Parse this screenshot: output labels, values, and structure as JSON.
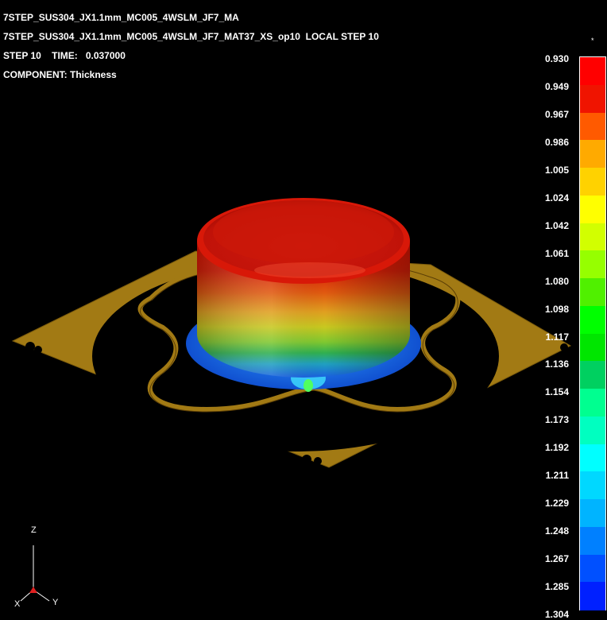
{
  "header": {
    "line1": "7STEP_SUS304_JX1.1mm_MC005_4WSLM_JF7_MA",
    "line2": "7STEP_SUS304_JX1.1mm_MC005_4WSLM_JF7_MAT37_XS_op10  LOCAL STEP 10",
    "step_label": "STEP 10    TIME:",
    "time_value": "0.037000",
    "component": "COMPONENT: Thickness"
  },
  "legend": {
    "marker": "*",
    "labels": [
      "0.930",
      "0.949",
      "0.967",
      "0.986",
      "1.005",
      "1.024",
      "1.042",
      "1.061",
      "1.080",
      "1.098",
      "1.117",
      "1.136",
      "1.154",
      "1.173",
      "1.192",
      "1.211",
      "1.229",
      "1.248",
      "1.267",
      "1.285",
      "1.304"
    ],
    "colors": [
      "#ff0000",
      "#f01400",
      "#ff5a00",
      "#ffaa00",
      "#ffd200",
      "#ffff00",
      "#d2ff00",
      "#96ff00",
      "#50f000",
      "#00ff00",
      "#00e600",
      "#00d060",
      "#00ff90",
      "#00ffc0",
      "#00ffff",
      "#00d8ff",
      "#00b4ff",
      "#0080ff",
      "#0050ff",
      "#0020ff"
    ]
  },
  "axes": {
    "z": "Z",
    "x": "X",
    "y": "Y"
  }
}
